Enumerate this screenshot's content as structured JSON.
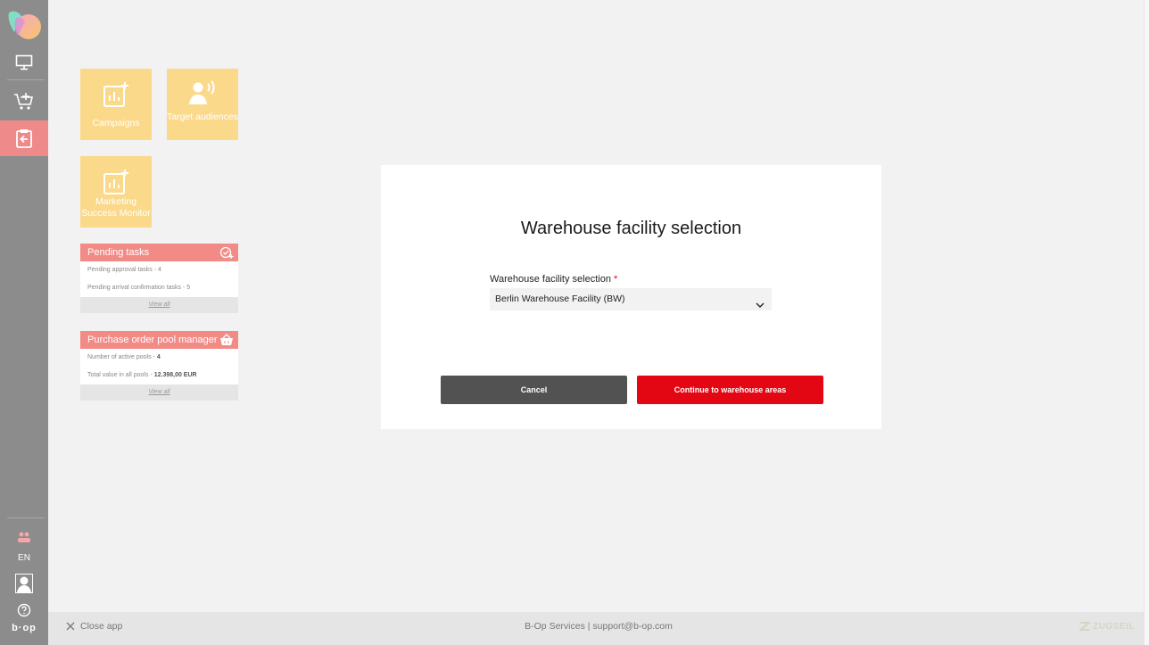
{
  "sidebar": {
    "language": "EN",
    "brand": "b-op",
    "items": [
      {
        "name": "dashboard",
        "icon": "monitor-icon"
      },
      {
        "name": "shop",
        "icon": "cart-add-icon"
      },
      {
        "name": "inbound",
        "icon": "clipboard-arrow-icon"
      }
    ]
  },
  "tiles": [
    {
      "label": "Campaigns",
      "icon": "chart-add-icon"
    },
    {
      "label": "Target audiences",
      "icon": "speaking-person-icon"
    },
    {
      "label": "Marketing Success Monitor",
      "icon": "chart-add-icon"
    }
  ],
  "widgets": {
    "pending_tasks": {
      "title": "Pending tasks",
      "lines": [
        "Pending approval tasks - 4",
        "Pending arrival confirmation tasks - 5"
      ],
      "view_all": "View all"
    },
    "po_pool": {
      "title": "Purchase order pool manager",
      "line1_prefix": "Number of active pools - ",
      "line1_value": "4",
      "line2_prefix": "Total value in all pools - ",
      "line2_value": "12.398,00 EUR",
      "view_all": "View all"
    }
  },
  "modal": {
    "title": "Warehouse facility selection",
    "field_label": "Warehouse facility selection",
    "required_mark": "*",
    "selected_value": "Berlin Warehouse Facility (BW)",
    "cancel_label": "Cancel",
    "continue_label": "Continue to warehouse areas"
  },
  "footer": {
    "close_app": "Close app",
    "services": "B-Op Services | support@b-op.com",
    "brand": "ZUGSEIL"
  },
  "colors": {
    "sidebar": "#8c8c8c",
    "active": "#ef8a8a",
    "tile": "#fbd98b",
    "widget_header": "#f28b86",
    "primary": "#e30613",
    "cancel": "#525252"
  }
}
